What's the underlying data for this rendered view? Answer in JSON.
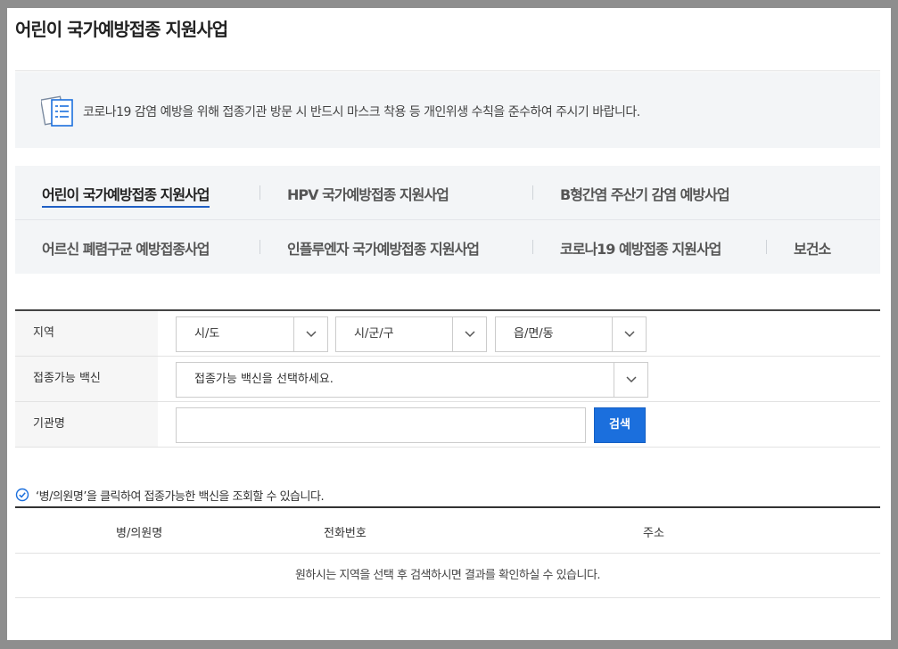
{
  "page": {
    "title": "어린이 국가예방접종 지원사업"
  },
  "notice": {
    "icon": "document-list-icon",
    "text": "코로나19 감염 예방을 위해 접종기관 방문 시 반드시 마스크 착용 등 개인위생 수칙을 준수하여 주시기 바랍니다."
  },
  "tabs": [
    {
      "label": "어린이 국가예방접종 지원사업",
      "active": true
    },
    {
      "label": "HPV 국가예방접종 지원사업",
      "active": false
    },
    {
      "label": "B형간염 주산기 감염 예방사업",
      "active": false
    },
    {
      "label": "어르신 폐렴구균 예방접종사업",
      "active": false
    },
    {
      "label": "인플루엔자 국가예방접종 지원사업",
      "active": false
    },
    {
      "label": "코로나19 예방접종 지원사업",
      "active": false
    },
    {
      "label": "보건소",
      "active": false
    }
  ],
  "form": {
    "region_label": "지역",
    "sido": "시/도",
    "sigungu": "시/군/구",
    "eupmyeondong": "읍/면/동",
    "vaccine_label": "접종가능 백신",
    "vaccine_select": "접종가능 백신을 선택하세요.",
    "institution_label": "기관명",
    "institution_value": "",
    "search_button": "검색"
  },
  "hint": {
    "icon": "check-circle-icon",
    "text": "‘병/의원명’을 클릭하여 접종가능한 백신을 조회할 수 있습니다."
  },
  "results": {
    "columns": [
      "병/의원명",
      "전화번호",
      "주소"
    ],
    "empty_message": "원하시는 지역을 선택 후 검색하시면 결과를 확인하실 수 있습니다."
  },
  "colors": {
    "accent": "#1b6fdd",
    "active_tab_underline": "#1f5fc4",
    "panel_bg": "#f3f5f7",
    "frame_bg": "#8e8e8e"
  }
}
